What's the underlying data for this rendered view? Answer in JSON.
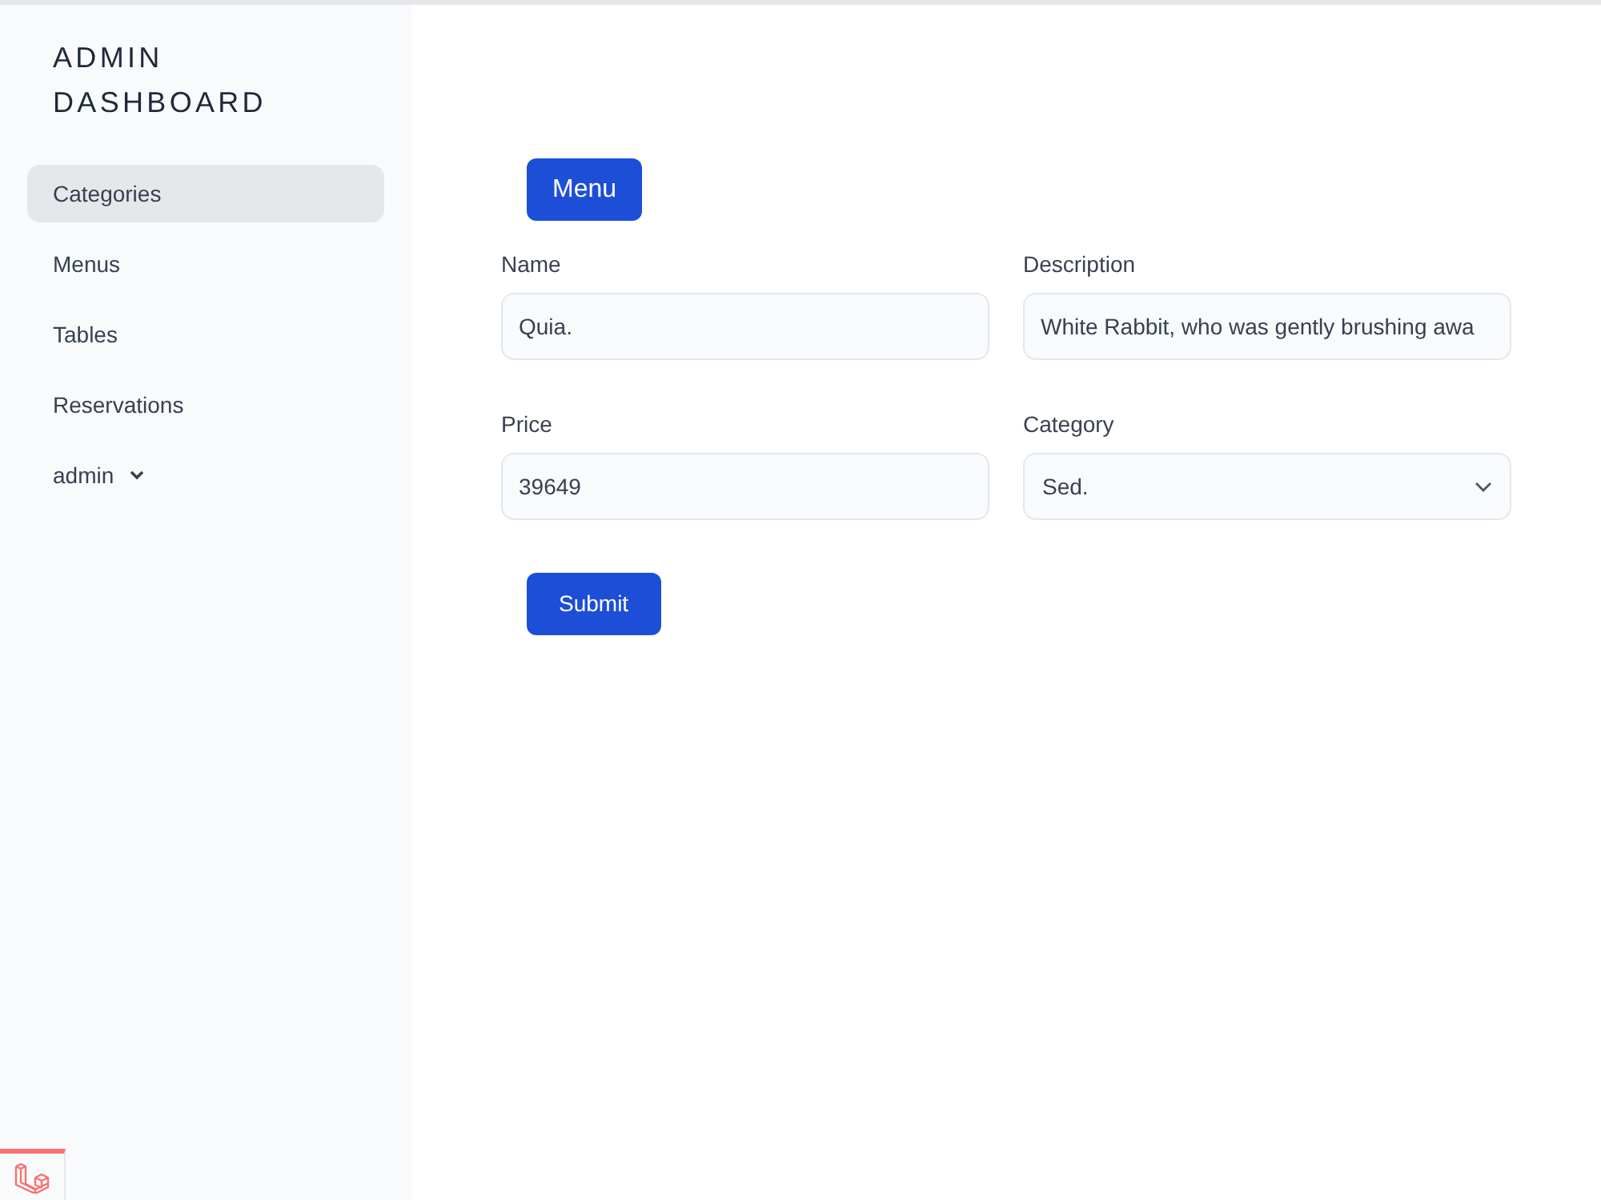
{
  "sidebar": {
    "title": "ADMIN DASHBOARD",
    "items": [
      {
        "label": "Categories",
        "selected": true
      },
      {
        "label": "Menus",
        "selected": false
      },
      {
        "label": "Tables",
        "selected": false
      },
      {
        "label": "Reservations",
        "selected": false
      }
    ],
    "user_menu": {
      "label": "admin"
    }
  },
  "main": {
    "menu_button": "Menu",
    "fields": [
      {
        "kind": "text",
        "label": "Name",
        "value": "Quia."
      },
      {
        "kind": "text",
        "label": "Description",
        "value": "White Rabbit, who was gently brushing awa"
      },
      {
        "kind": "text",
        "label": "Price",
        "value": "39649"
      },
      {
        "kind": "select",
        "label": "Category",
        "value": "Sed."
      }
    ],
    "submit_button": "Submit"
  }
}
